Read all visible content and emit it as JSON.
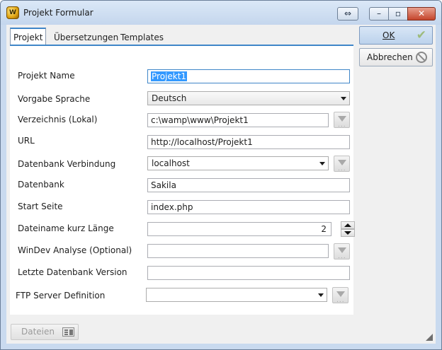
{
  "window": {
    "title": "Projekt Formular",
    "icon": "windev-logo-icon",
    "icon_text": "W"
  },
  "titlebar_buttons": {
    "restore_glyph": "⇔",
    "minimize_glyph": "–",
    "maximize_glyph": "▫",
    "close_glyph": "✕"
  },
  "tabs": [
    {
      "label": "Projekt",
      "active": true
    },
    {
      "label": "Übersetzungen",
      "active": false
    },
    {
      "label": "Templates",
      "active": false
    }
  ],
  "form": {
    "project_name": {
      "label": "Projekt Name",
      "value": "Projekt1"
    },
    "default_language": {
      "label": "Vorgabe Sprache",
      "value": "Deutsch"
    },
    "directory": {
      "label": "Verzeichnis (Lokal)",
      "value": "c:\\wamp\\www\\Projekt1"
    },
    "url": {
      "label": "URL",
      "value": "http://localhost/Projekt1"
    },
    "db_connection": {
      "label": "Datenbank Verbindung",
      "value": "localhost"
    },
    "database": {
      "label": "Datenbank",
      "value": "Sakila"
    },
    "start_page": {
      "label": "Start Seite",
      "value": "index.php"
    },
    "short_filename_length": {
      "label": "Dateiname kurz Länge",
      "value": "2"
    },
    "windev_analysis": {
      "label": "WinDev Analyse (Optional)",
      "value": ""
    },
    "last_db_version": {
      "label": "Letzte Datenbank Version",
      "value": ""
    },
    "ftp_server": {
      "label": "FTP Server Definition",
      "value": ""
    }
  },
  "buttons": {
    "ok_label": "OK",
    "cancel_label": "Abbrechen",
    "files_label": "Dateien"
  },
  "colors": {
    "accent": "#3f86c8",
    "selection": "#3399ff",
    "window_frame": "#c9daef"
  }
}
